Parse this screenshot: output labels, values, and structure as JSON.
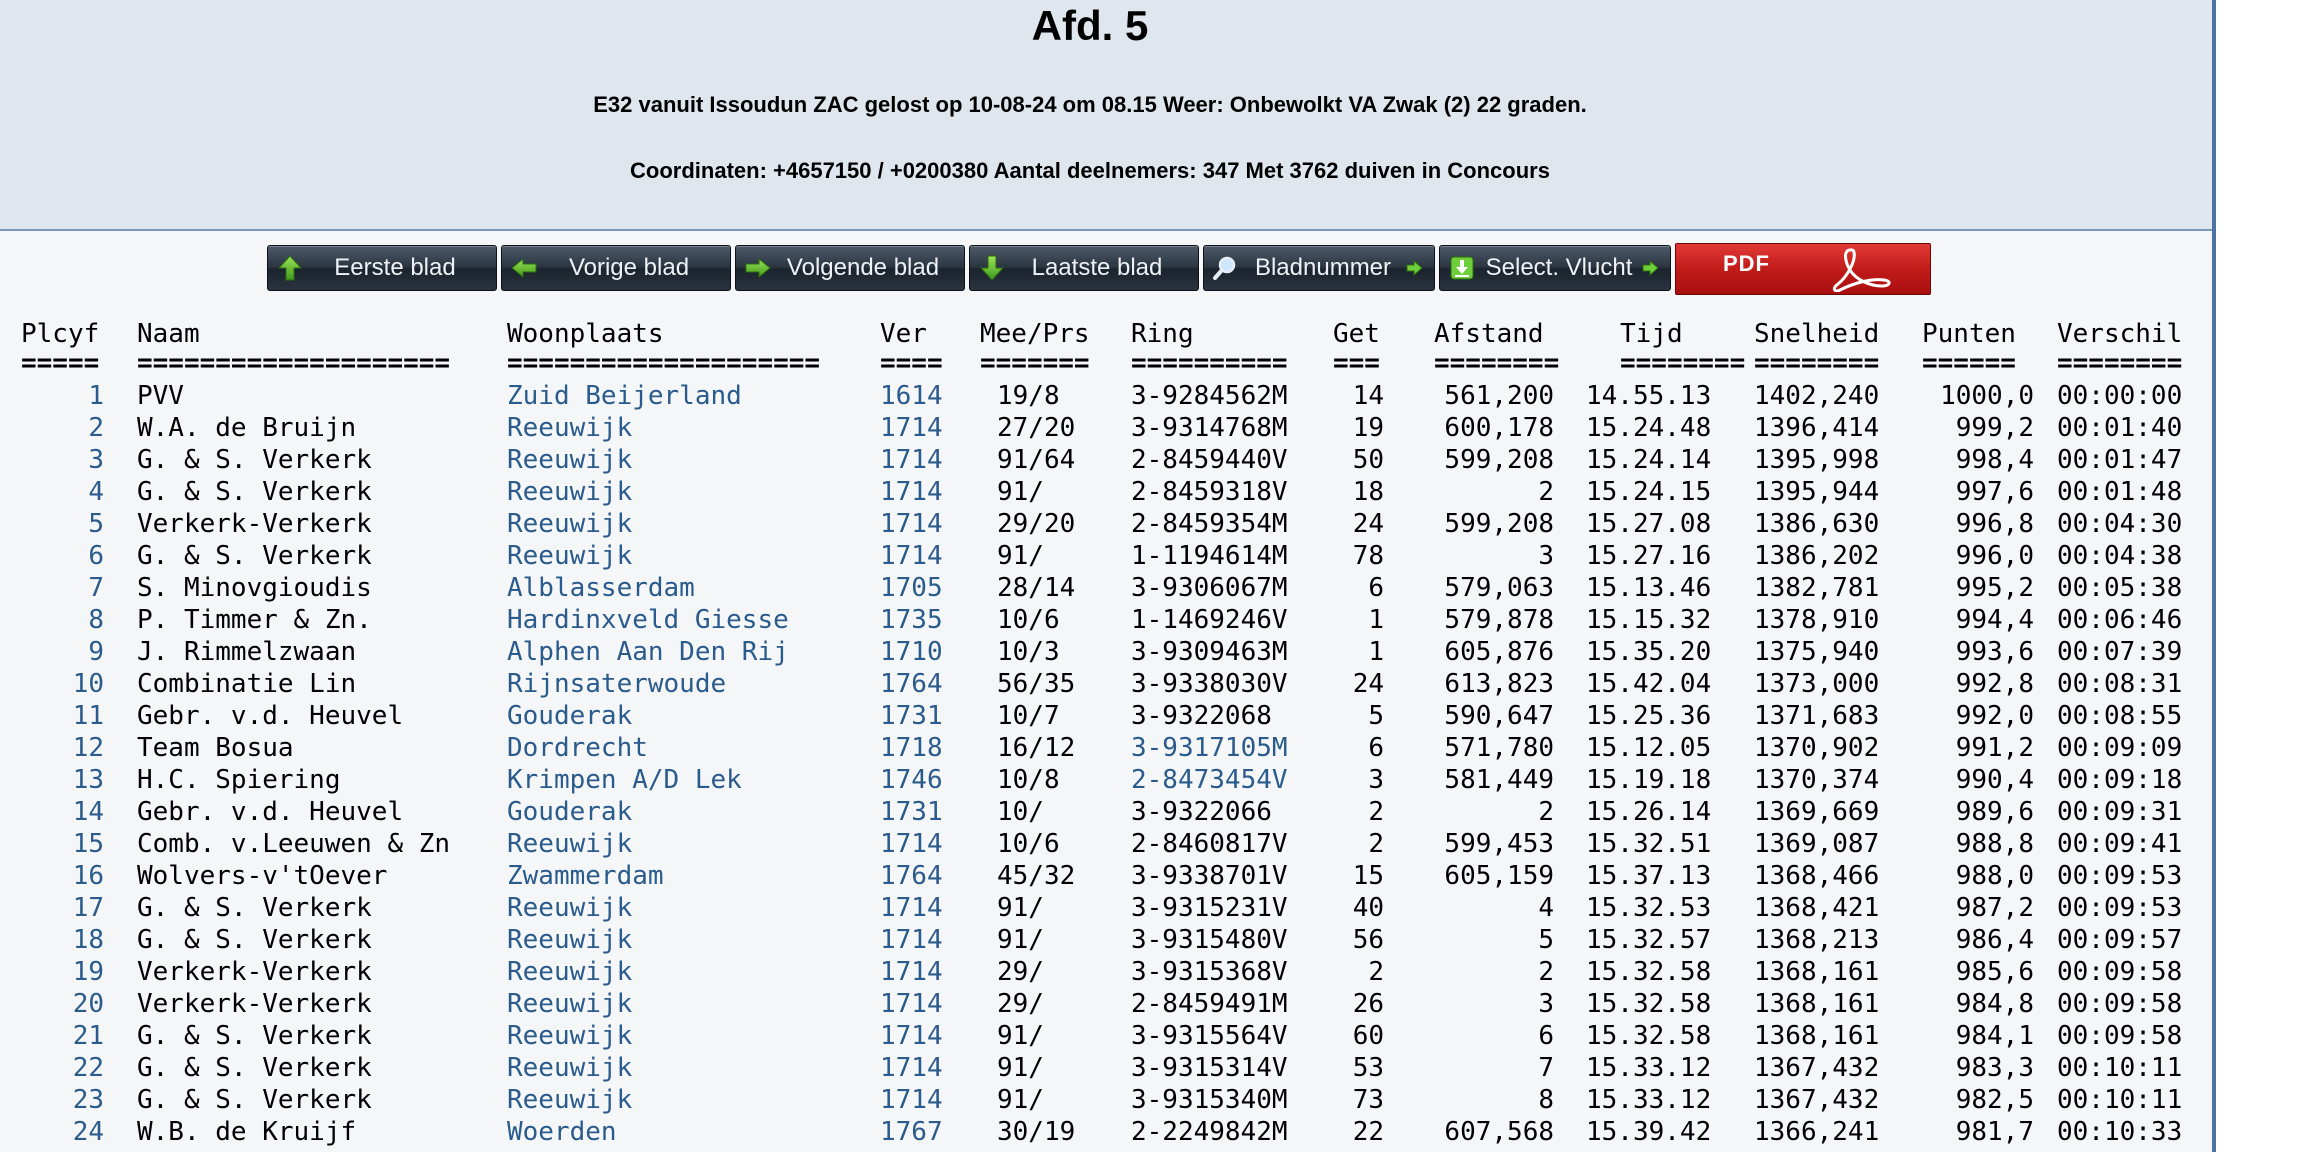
{
  "header": {
    "title": "Afd. 5",
    "info_line_1": "E32 vanuit Issoudun ZAC gelost op 10-08-24 om 08.15 Weer: Onbewolkt VA Zwak (2) 22 graden.",
    "info_line_2": "Coordinaten: +4657150 / +0200380 Aantal deelnemers: 347 Met 3762 duiven in Concours"
  },
  "toolbar": {
    "buttons": [
      {
        "label": "Eerste blad",
        "icon": "arrow-up-icon"
      },
      {
        "label": "Vorige blad",
        "icon": "arrow-left-icon"
      },
      {
        "label": "Volgende blad",
        "icon": "arrow-right-icon"
      },
      {
        "label": "Laatste blad",
        "icon": "arrow-down-icon"
      },
      {
        "label": "Bladnummer",
        "icon": "magnifier-icon"
      },
      {
        "label": "Select. Vlucht",
        "icon": "download-icon"
      }
    ],
    "pdf_label": "PDF",
    "pdf_icon": "adobe-acrobat-icon"
  },
  "table": {
    "columns": [
      "Plcyf",
      "Naam",
      "Woonplaats",
      "Ver",
      "Mee/Prs",
      "Ring",
      "Get",
      "Afstand",
      "Tijd",
      "Snelheid",
      "Punten",
      "Verschil"
    ],
    "separators": [
      "=====",
      "====================",
      "====================",
      "====",
      "=======",
      "==========",
      "===",
      "========",
      "========",
      "========",
      "======",
      "========"
    ],
    "rows": [
      [
        "1",
        "PVV",
        "Zuid Beijerland",
        "1614",
        "19/8",
        "3-9284562M",
        "14",
        "561,200",
        "14.55.13",
        "1402,240",
        "1000,0",
        "00:00:00"
      ],
      [
        "2",
        "W.A. de Bruijn",
        "Reeuwijk",
        "1714",
        "27/20",
        "3-9314768M",
        "19",
        "600,178",
        "15.24.48",
        "1396,414",
        "999,2",
        "00:01:40"
      ],
      [
        "3",
        "G. & S. Verkerk",
        "Reeuwijk",
        "1714",
        "91/64",
        "2-8459440V",
        "50",
        "599,208",
        "15.24.14",
        "1395,998",
        "998,4",
        "00:01:47"
      ],
      [
        "4",
        "G. & S. Verkerk",
        "Reeuwijk",
        "1714",
        "91/",
        "2-8459318V",
        "18",
        "2",
        "15.24.15",
        "1395,944",
        "997,6",
        "00:01:48"
      ],
      [
        "5",
        "Verkerk-Verkerk",
        "Reeuwijk",
        "1714",
        "29/20",
        "2-8459354M",
        "24",
        "599,208",
        "15.27.08",
        "1386,630",
        "996,8",
        "00:04:30"
      ],
      [
        "6",
        "G. & S. Verkerk",
        "Reeuwijk",
        "1714",
        "91/",
        "1-1194614M",
        "78",
        "3",
        "15.27.16",
        "1386,202",
        "996,0",
        "00:04:38"
      ],
      [
        "7",
        "S. Minovgioudis",
        "Alblasserdam",
        "1705",
        "28/14",
        "3-9306067M",
        "6",
        "579,063",
        "15.13.46",
        "1382,781",
        "995,2",
        "00:05:38"
      ],
      [
        "8",
        "P. Timmer & Zn.",
        "Hardinxveld Giesse",
        "1735",
        "10/6",
        "1-1469246V",
        "1",
        "579,878",
        "15.15.32",
        "1378,910",
        "994,4",
        "00:06:46"
      ],
      [
        "9",
        "J. Rimmelzwaan",
        "Alphen Aan Den Rij",
        "1710",
        "10/3",
        "3-9309463M",
        "1",
        "605,876",
        "15.35.20",
        "1375,940",
        "993,6",
        "00:07:39"
      ],
      [
        "10",
        "Combinatie Lin",
        "Rijnsaterwoude",
        "1764",
        "56/35",
        "3-9338030V",
        "24",
        "613,823",
        "15.42.04",
        "1373,000",
        "992,8",
        "00:08:31"
      ],
      [
        "11",
        "Gebr. v.d. Heuvel",
        "Gouderak",
        "1731",
        "10/7",
        "3-9322068",
        "5",
        "590,647",
        "15.25.36",
        "1371,683",
        "992,0",
        "00:08:55"
      ],
      [
        "12",
        "Team Bosua",
        "Dordrecht",
        "1718",
        "16/12",
        "3-9317105M",
        "6",
        "571,780",
        "15.12.05",
        "1370,902",
        "991,2",
        "00:09:09"
      ],
      [
        "13",
        "H.C. Spiering",
        "Krimpen A/D Lek",
        "1746",
        "10/8",
        "2-8473454V",
        "3",
        "581,449",
        "15.19.18",
        "1370,374",
        "990,4",
        "00:09:18"
      ],
      [
        "14",
        "Gebr. v.d. Heuvel",
        "Gouderak",
        "1731",
        "10/",
        "3-9322066",
        "2",
        "2",
        "15.26.14",
        "1369,669",
        "989,6",
        "00:09:31"
      ],
      [
        "15",
        "Comb. v.Leeuwen & Zn",
        "Reeuwijk",
        "1714",
        "10/6",
        "2-8460817V",
        "2",
        "599,453",
        "15.32.51",
        "1369,087",
        "988,8",
        "00:09:41"
      ],
      [
        "16",
        "Wolvers-v'tOever",
        "Zwammerdam",
        "1764",
        "45/32",
        "3-9338701V",
        "15",
        "605,159",
        "15.37.13",
        "1368,466",
        "988,0",
        "00:09:53"
      ],
      [
        "17",
        "G. & S. Verkerk",
        "Reeuwijk",
        "1714",
        "91/",
        "3-9315231V",
        "40",
        "4",
        "15.32.53",
        "1368,421",
        "987,2",
        "00:09:53"
      ],
      [
        "18",
        "G. & S. Verkerk",
        "Reeuwijk",
        "1714",
        "91/",
        "3-9315480V",
        "56",
        "5",
        "15.32.57",
        "1368,213",
        "986,4",
        "00:09:57"
      ],
      [
        "19",
        "Verkerk-Verkerk",
        "Reeuwijk",
        "1714",
        "29/",
        "3-9315368V",
        "2",
        "2",
        "15.32.58",
        "1368,161",
        "985,6",
        "00:09:58"
      ],
      [
        "20",
        "Verkerk-Verkerk",
        "Reeuwijk",
        "1714",
        "29/",
        "2-8459491M",
        "26",
        "3",
        "15.32.58",
        "1368,161",
        "984,8",
        "00:09:58"
      ],
      [
        "21",
        "G. & S. Verkerk",
        "Reeuwijk",
        "1714",
        "91/",
        "3-9315564V",
        "60",
        "6",
        "15.32.58",
        "1368,161",
        "984,1",
        "00:09:58"
      ],
      [
        "22",
        "G. & S. Verkerk",
        "Reeuwijk",
        "1714",
        "91/",
        "3-9315314V",
        "53",
        "7",
        "15.33.12",
        "1367,432",
        "983,3",
        "00:10:11"
      ],
      [
        "23",
        "G. & S. Verkerk",
        "Reeuwijk",
        "1714",
        "91/",
        "3-9315340M",
        "73",
        "8",
        "15.33.12",
        "1367,432",
        "982,5",
        "00:10:11"
      ],
      [
        "24",
        "W.B. de Kruijf",
        "Woerden",
        "1767",
        "30/19",
        "2-2249842M",
        "22",
        "607,568",
        "15.39.42",
        "1366,241",
        "981,7",
        "00:10:33"
      ]
    ],
    "linked_rings": [
      "3-9317105M",
      "2-8473454V"
    ]
  },
  "colors": {
    "header_bg": "#dfe6ee",
    "table_bg": "#f4f6f8",
    "link": "#2a5b8c",
    "button_dark": "#2b3541",
    "pdf_red": "#c01c1a",
    "frame_blue": "#4a74a8"
  }
}
